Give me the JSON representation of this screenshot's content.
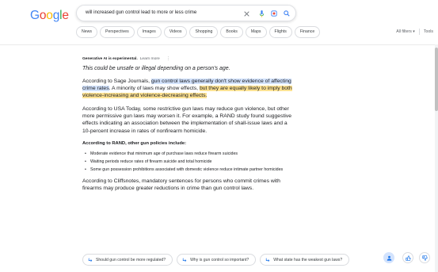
{
  "header": {
    "logo": {
      "letters": [
        "G",
        "o",
        "o",
        "g",
        "l",
        "e"
      ],
      "colors": [
        "#4285F4",
        "#EA4335",
        "#FBBC05",
        "#4285F4",
        "#34A853",
        "#EA4335"
      ]
    },
    "search": {
      "query": "will increased gun control lead to more or less crime",
      "icons": [
        "close-icon",
        "mic-icon",
        "lens-icon",
        "search-icon"
      ]
    },
    "filters": [
      "News",
      "Perspectives",
      "Images",
      "Videos",
      "Shopping",
      "Books",
      "Maps",
      "Flights",
      "Finance"
    ],
    "all_filters_label": "All filters",
    "tools_label": "Tools"
  },
  "ai_overview": {
    "notice_bold": "Generative AI is experimental.",
    "notice_link": "Learn more",
    "warning": "This could be unsafe or illegal depending on a person's age.",
    "p1": {
      "plain_start": "According to Sage Journals, ",
      "highlight_blue": "gun control laws generally don't show evidence of affecting crime rates",
      "plain_mid": ". A minority of laws may show effects, ",
      "highlight_orange": "but they are equally likely to imply both violence-increasing and violence-decreasing effects",
      "plain_end": "."
    },
    "p2": "According to USA Today, some restrictive gun laws may reduce gun violence, but other more permissive gun laws may worsen it. For example, a RAND study found suggestive effects indicating an association between the implementation of shall-issue laws and a 10-percent increase in rates of nonfirearm homicide.",
    "subheading": "According to RAND, other gun policies include:",
    "bullets": [
      "Moderate evidence that minimum age of purchase laws reduce firearm suicides",
      "Waiting periods reduce rates of firearm suicide and total homicide",
      "Some gun possession prohibitions associated with domestic violence reduce intimate partner homicides"
    ],
    "p3": "According to Cliffsnotes, mandatory sentences for persons who commit crimes with firearms may produce greater reductions in crime than gun control laws."
  },
  "followups": [
    "Should gun control be more regulated?",
    "Why is gun control so important?",
    "What state has the weakest gun laws?"
  ],
  "feedback_icons": [
    "share-icon",
    "thumbs-up-icon",
    "thumbs-down-icon"
  ],
  "colors": {
    "highlight_blue": "#d3e3fd",
    "highlight_orange": "#fde293",
    "accent": "#1a73e8"
  }
}
